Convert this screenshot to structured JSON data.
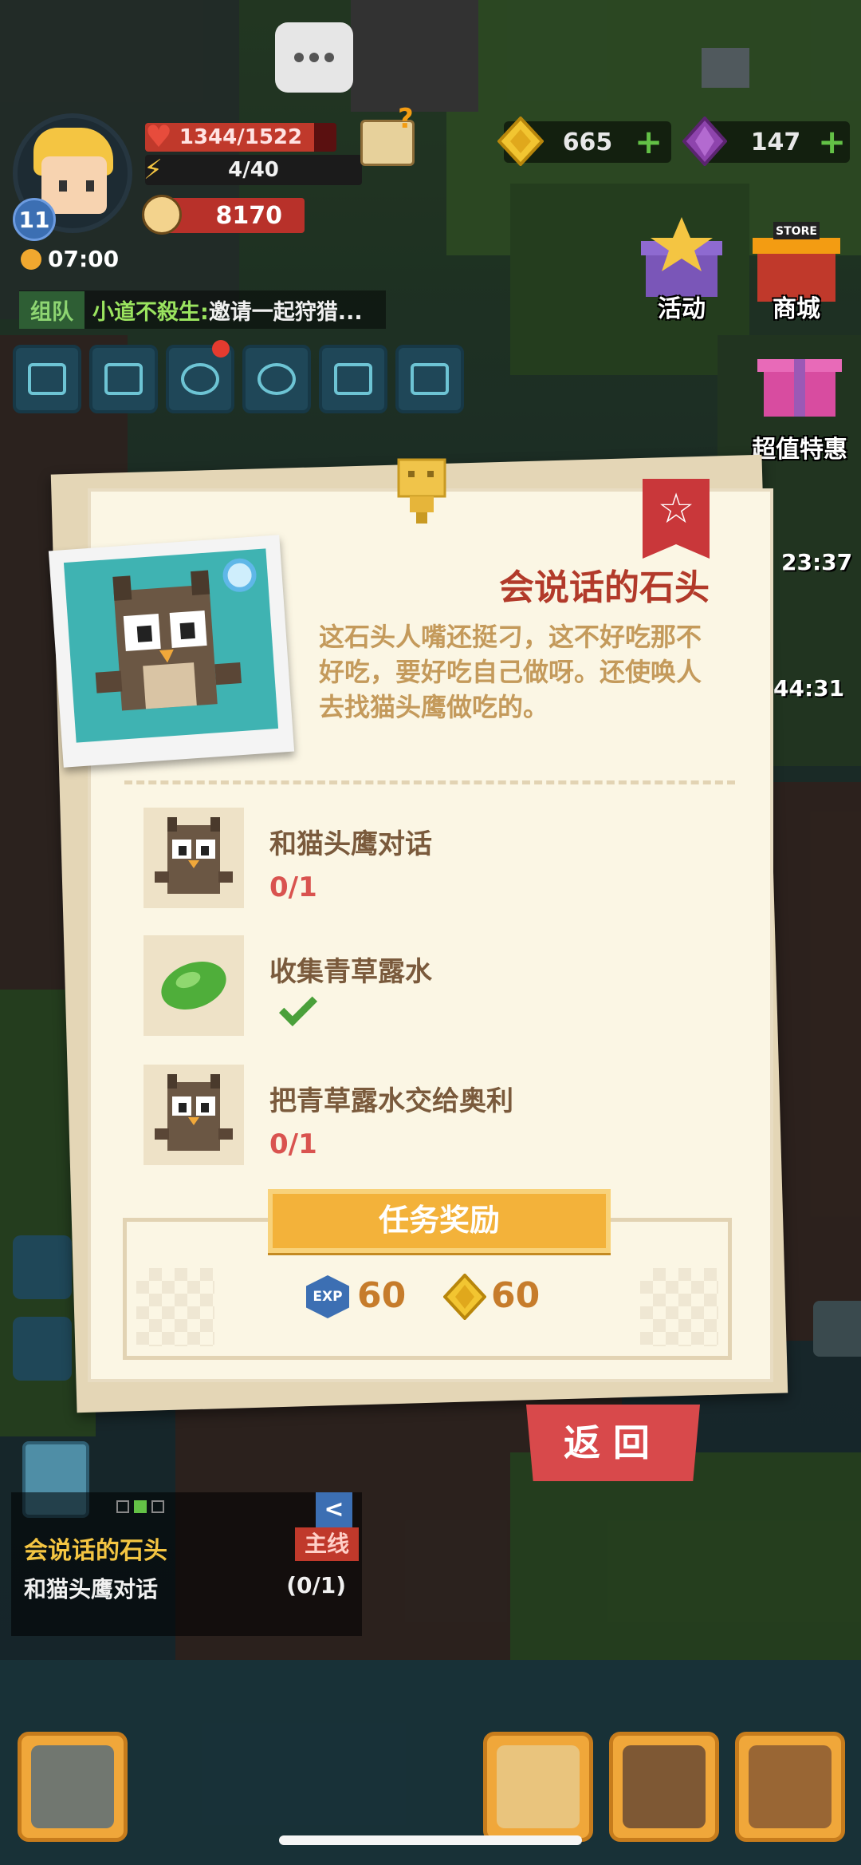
{
  "hud": {
    "hp": {
      "text": "1344/1522",
      "value": 1344,
      "max": 1522
    },
    "energy": {
      "text": "4/40"
    },
    "power": "8170",
    "level": "11",
    "clock": "07:00",
    "gold": "665",
    "gems": "147",
    "plus": "+"
  },
  "chat": {
    "tag": "组队",
    "sender": "小道不殺生:",
    "message": "邀请一起狩猎..."
  },
  "shop": {
    "activity_label": "活动",
    "store_label": "商城",
    "store_sign": "STORE",
    "deal_label": "超值特惠"
  },
  "side_timers": {
    "t1": "23:37",
    "t2": "44:31"
  },
  "quest": {
    "title": "会说话的石头",
    "description": "这石头人嘴还挺刁，这不好吃那不好吃，要好吃自己做呀。还使唤人去找猫头鹰做吃的。",
    "tasks": [
      {
        "name": "和猫头鹰对话",
        "progress": "0/1",
        "done": false
      },
      {
        "name": "收集青草露水",
        "progress": "",
        "done": true
      },
      {
        "name": "把青草露水交给奥利",
        "progress": "0/1",
        "done": false
      }
    ],
    "reward_header": "任务奖励",
    "rewards": {
      "exp_label": "EXP",
      "exp": "60",
      "gold": "60"
    },
    "back": "返回"
  },
  "tracker": {
    "title": "会说话的石头",
    "type": "主线",
    "task": "和猫头鹰对话",
    "progress": "(0/1)",
    "collapse": "<"
  },
  "colors": {
    "title_red": "#b23a2a",
    "desc_tan": "#c49a5b",
    "progress_red": "#d9534f",
    "reward_orange": "#f3b23a"
  }
}
